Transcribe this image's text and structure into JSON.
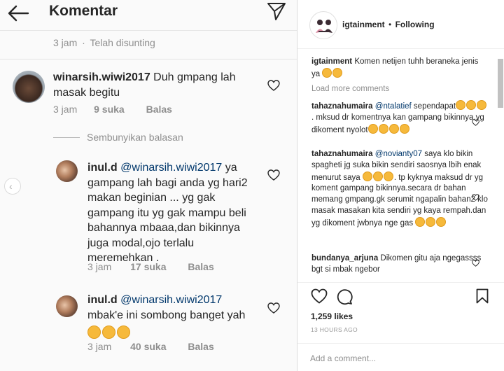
{
  "left_panel": {
    "title": "Komentar",
    "top_meta": {
      "time": "3 jam",
      "sep": "·",
      "edited": "Telah disunting"
    },
    "comment_main": {
      "user": "winarsih.wiwi2017",
      "text": " Duh gmpang lah masak begitu",
      "time": "3 jam",
      "likes": "9 suka",
      "reply": "Balas"
    },
    "hide_replies": "Sembunyikan balasan",
    "reply_1": {
      "user": "inul.d",
      "mention": "@winarsih.wiwi2017",
      "text": "  ya gampang lah bagi anda yg hari2 makan beginian ... yg gak gampang itu yg gak mampu beli bahannya mbaaa,dan bikinnya juga modal,ojo terlalu meremehkan .",
      "time": "3 jam",
      "likes": "17 suka",
      "reply": "Balas"
    },
    "reply_2": {
      "user": "inul.d",
      "mention": "@winarsih.wiwi2017",
      "text": " mbak'e ini sombong banget yah",
      "time": "3 jam",
      "likes": "40 suka",
      "reply": "Balas"
    }
  },
  "right_panel": {
    "post_user": "igtainment",
    "post_dot": "•",
    "follow_status": "Following",
    "caption": {
      "user": "igtainment",
      "text": " Komen netijen tuhh beraneka jenis ya"
    },
    "load_more": "Load more comments",
    "comments": [
      {
        "user": "tahaznahumaira",
        "mention": "@ntalatief",
        "text": " sependapat",
        "text2": ". mksud dr komentnya kan gampang bikinnya.yg dikoment nyolot"
      },
      {
        "user": "tahaznahumaira",
        "mention": "@novianty07",
        "text": " saya klo bikin spagheti jg suka bikin sendiri saosnya lbih enak menurut saya",
        "text2": ". tp kyknya maksud dr yg koment gampang bikinnya.secara dr bahan memang gmpang.gk serumit ngapalin bahan2 klo masak masakan kita sendiri yg kaya rempah.dan yg dikoment jwbnya nge gas"
      },
      {
        "user": "bundanya_arjuna",
        "mention": "",
        "text": " Dikomen gitu aja ngegassss bgt si mbak ngebor",
        "text2": ""
      }
    ],
    "likes": "1,259 likes",
    "time": "13 HOURS AGO",
    "add_comment_placeholder": "Add a comment..."
  },
  "colors": {
    "link_blue": "#00376b",
    "muted": "#8e8e8e",
    "text": "#262626",
    "emoji_yellow": "#f6b93b"
  },
  "icons": [
    "back-arrow-icon",
    "send-icon",
    "heart-icon",
    "comment-icon",
    "bookmark-icon",
    "chevron-left-icon",
    "emoji-icon"
  ]
}
